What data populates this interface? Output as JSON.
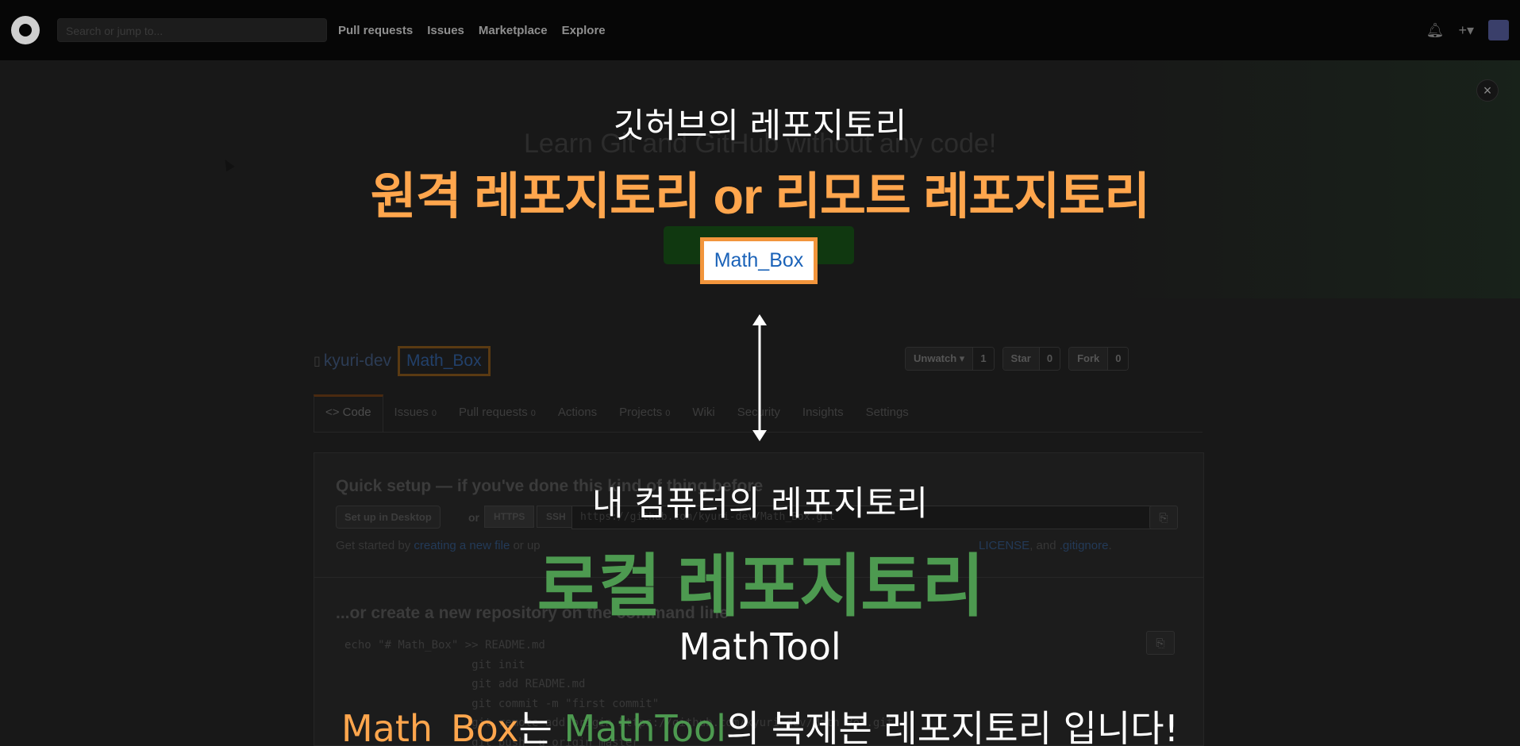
{
  "header": {
    "search_placeholder": "Search or jump to...",
    "nav": [
      "Pull requests",
      "Issues",
      "Marketplace",
      "Explore"
    ],
    "bell_icon": "bell-icon",
    "plus_icon": "plus-icon"
  },
  "page": {
    "close_label": "×",
    "learn_title": "Learn Git and GitHub without any code!",
    "repo_owner": "kyuri-dev",
    "repo_name": "Math_Box",
    "actions": [
      {
        "label": "Unwatch ▾",
        "count": "1"
      },
      {
        "label": "Star",
        "count": "0"
      },
      {
        "label": "Fork",
        "count": "0"
      }
    ],
    "tabs": [
      {
        "label": "<> Code",
        "count": ""
      },
      {
        "label": "Issues",
        "count": "0"
      },
      {
        "label": "Pull requests",
        "count": "0"
      },
      {
        "label": "Actions",
        "count": ""
      },
      {
        "label": "Projects",
        "count": "0"
      },
      {
        "label": "Wiki",
        "count": ""
      },
      {
        "label": "Security",
        "count": ""
      },
      {
        "label": "Insights",
        "count": ""
      },
      {
        "label": "Settings",
        "count": ""
      }
    ],
    "quick_setup": {
      "title": "Quick setup — if you've done this kind of thing before",
      "desktop_btn": "Set up in Desktop",
      "or": "or",
      "https": "HTTPS",
      "ssh": "SSH",
      "url": "https://github.com/kyuri-dev/Math_Box.git",
      "help_prefix": "Get started by ",
      "help_link": "creating a new file",
      "help_mid": " or up",
      "help_tail_prefix": "LICENSE",
      "help_tail_mid": ", and ",
      "help_tail_link": ".gitignore",
      "help_tail_end": "."
    },
    "command_line": {
      "title": "...or create a new repository on the command line",
      "code": "echo \"# Math_Box\" >> README.md\n                   git init\n                   git add README.md\n                   git commit -m \"first commit\"\n                   git remote add origin https://github.com/kyuri-dev/Math_Box.git\n                   git push -u origin master"
    }
  },
  "overlay": {
    "remote_caption": "깃허브의 레포지토리",
    "remote_title": "원격 레포지토리 or 리모트 레포지토리",
    "remote_repo_chip": "Math_Box",
    "local_caption": "내 컴퓨터의 레포지토리",
    "local_title": "로컬 레포지토리",
    "local_repo_name": "MathTool",
    "subtitle_part1": "Math_Box",
    "subtitle_part2": "는 ",
    "subtitle_part3": "MathTool",
    "subtitle_part4": "의 복제본 레포지토리 입니다!",
    "colors": {
      "orange": "#ffa64d",
      "green": "#4d9a50",
      "chip_border": "#f2953c",
      "chip_text": "#1a62b8"
    }
  }
}
